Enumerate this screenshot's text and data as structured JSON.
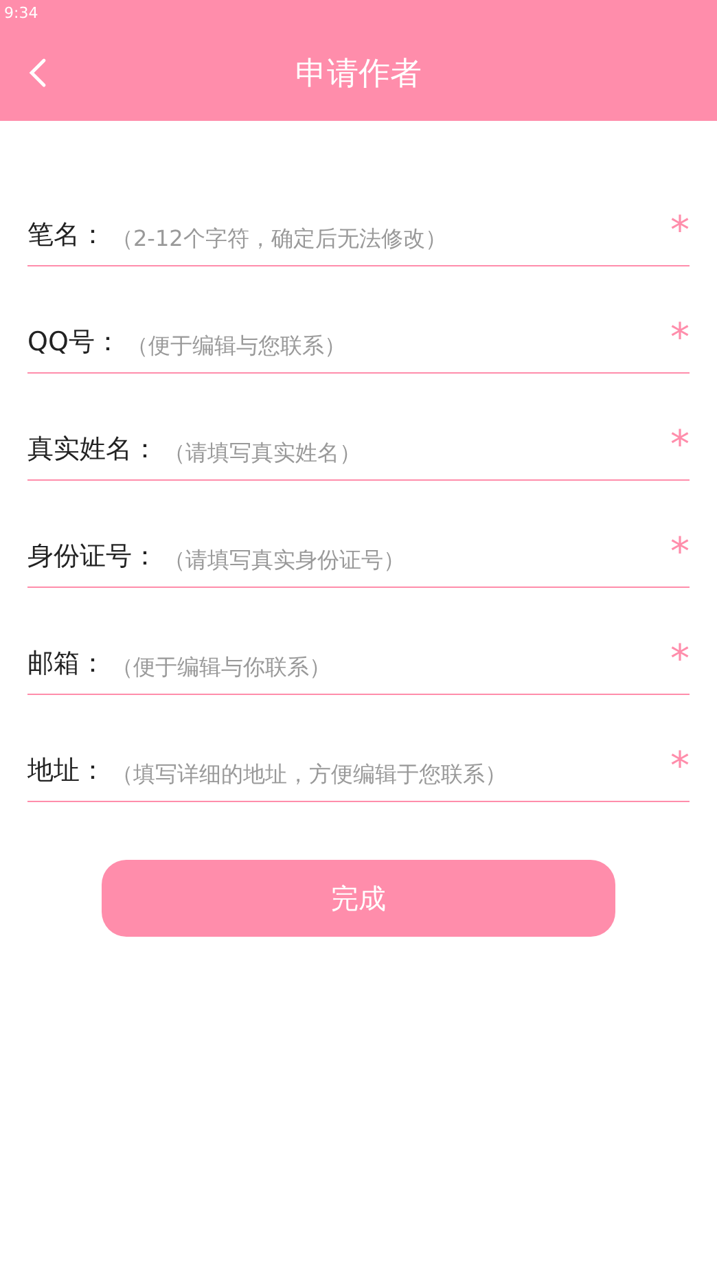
{
  "status_bar": {
    "time": "9:34"
  },
  "header": {
    "title": "申请作者"
  },
  "fields": [
    {
      "label": "笔名：",
      "placeholder": "（2-12个字符，确定后无法修改）",
      "required_mark": "*"
    },
    {
      "label": "QQ号：",
      "placeholder": "（便于编辑与您联系）",
      "required_mark": "*"
    },
    {
      "label": "真实姓名：",
      "placeholder": "（请填写真实姓名）",
      "required_mark": "*"
    },
    {
      "label": "身份证号：",
      "placeholder": "（请填写真实身份证号）",
      "required_mark": "*"
    },
    {
      "label": "邮箱：",
      "placeholder": "（便于编辑与你联系）",
      "required_mark": "*"
    },
    {
      "label": "地址：",
      "placeholder": "（填写详细的地址，方便编辑于您联系）",
      "required_mark": "*"
    }
  ],
  "submit": "完成"
}
